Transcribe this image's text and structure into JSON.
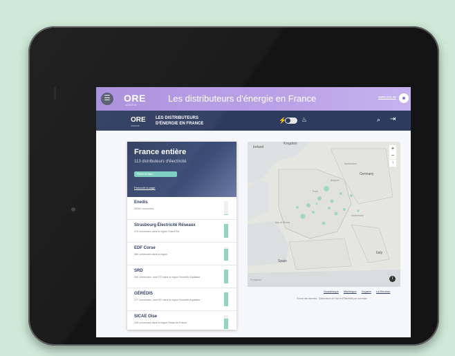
{
  "top_bar": {
    "logo": "ORE",
    "logo_sub": "AGENCE",
    "title": "Les distributeurs d'énergie en France",
    "link": "www.xxx.xx"
  },
  "nav_bar": {
    "logo": "ORE",
    "logo_sub": "AGENCE",
    "title_line1": "LES DISTRIBUTEURS",
    "title_line2": "D'ÉNERGIE EN FRANCE"
  },
  "panel": {
    "title": "France entière",
    "subtitle": "113 distributeurs d'électricité",
    "pill": "Filtrer la liste",
    "link": "Parcourir la page",
    "items": [
      {
        "name": "Enedis",
        "desc": "35260 communes",
        "level": 0.05
      },
      {
        "name": "Strasbourg Électricité Réseaux",
        "desc": "375 communes dans la région Grand Est",
        "level": 1.0
      },
      {
        "name": "EDF Corse",
        "desc": "360 communes dans la région",
        "level": 0.85
      },
      {
        "name": "SRD",
        "desc": "280 communes, dont 272 dans la région Nouvelle-Aquitaine",
        "level": 1.0
      },
      {
        "name": "GÉRÉDIS",
        "desc": "277 communes, dont 267 dans la région Nouvelle-Aquitaine",
        "level": 1.0
      },
      {
        "name": "SICAE Oise",
        "desc": "245 communes dans la région Hauts-de-France",
        "level": 0.75
      }
    ]
  },
  "map": {
    "labels": {
      "ireland": "Ireland",
      "kingdom": "Kingdom",
      "germany": "Germany",
      "belgium": "Belgium",
      "amsterdam": "Amsterdam",
      "paris": "Paris",
      "bay": "Bay of Biscay",
      "spain": "Spain",
      "italy": "Italy",
      "switzerland": "Switzerland",
      "mapbox": "© mapbox"
    }
  },
  "footer": {
    "dom_links": [
      "Guadeloupe",
      "Martinique",
      "Guyane",
      "La Réunion"
    ],
    "source": "Source des données : Distributeurs de Gaz et d'Électricité par commune"
  },
  "colors": {
    "topbar": "#a78ddc",
    "navbar": "#2d3b5e",
    "accent": "#7ccfbf"
  }
}
